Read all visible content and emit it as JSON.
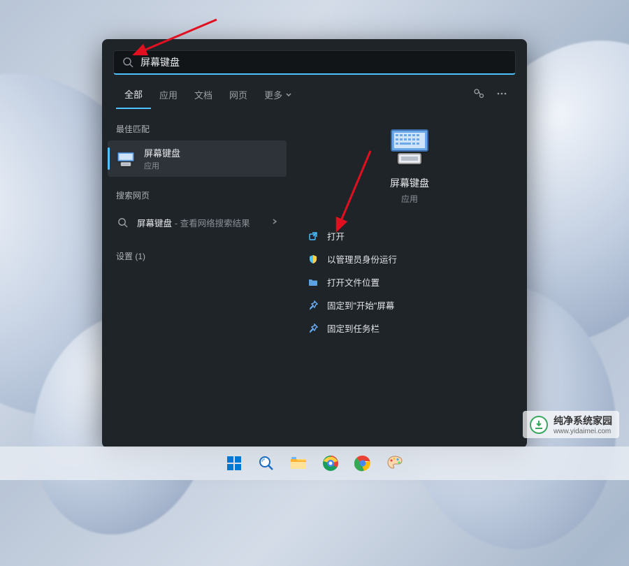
{
  "search": {
    "query": "屏幕键盘"
  },
  "tabs": {
    "all": "全部",
    "apps": "应用",
    "documents": "文档",
    "web": "网页",
    "more": "更多"
  },
  "left": {
    "best_match_label": "最佳匹配",
    "best_match": {
      "title": "屏幕键盘",
      "subtitle": "应用"
    },
    "search_web_label": "搜索网页",
    "search_web": {
      "term": "屏幕键盘",
      "hint": " - 查看网络搜索结果"
    },
    "settings_label": "设置 (1)"
  },
  "preview": {
    "title": "屏幕键盘",
    "subtitle": "应用"
  },
  "actions": {
    "open": "打开",
    "run_admin": "以管理员身份运行",
    "open_location": "打开文件位置",
    "pin_start": "固定到\"开始\"屏幕",
    "pin_taskbar": "固定到任务栏"
  },
  "watermark": {
    "brand": "纯净系统家园",
    "url": "www.yidaimei.com"
  }
}
